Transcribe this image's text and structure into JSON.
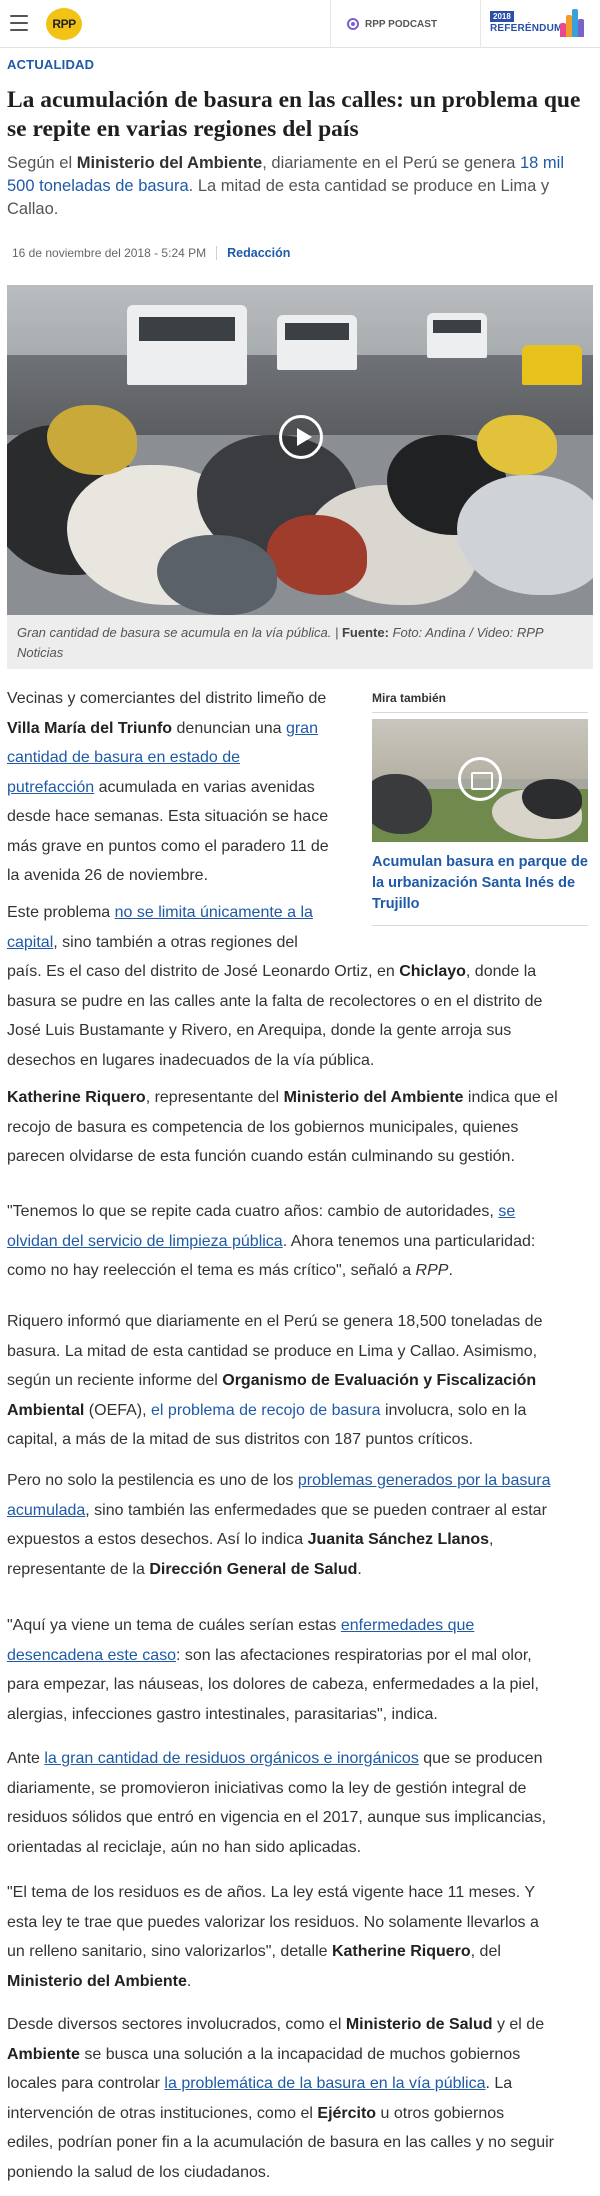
{
  "header": {
    "logo": "RPP",
    "podcast_label": "RPP PODCAST",
    "referendum_year": "2018",
    "referendum_label": "REFERÉNDUM"
  },
  "article": {
    "section": "ACTUALIDAD",
    "title": "La acumulación de basura en las calles: un problema que se repite en varias regiones del país",
    "lede": {
      "t1": "Según el ",
      "b1": "Ministerio del Ambiente",
      "t2": ", diariamente en el Perú se genera ",
      "hl": "18 mil 500 toneladas de basura",
      "t3": ". La mitad de esta cantidad se produce en Lima y Callao."
    },
    "date": "16 de noviembre del 2018 - 5:24 PM",
    "author": "Redacción",
    "caption": {
      "text": "Gran cantidad de basura se acumula en la vía pública. | ",
      "source_label": "Fuente:",
      "source_text": " Foto: Andina / Video: RPP Noticias"
    }
  },
  "related": {
    "heading": "Mira también",
    "title": "Acumulan basura en parque de la urbanización Santa Inés de Trujillo"
  },
  "body": {
    "p1": {
      "l1": "Vecinas y comerciantes del distrito limeño de",
      "b1": "Villa María del Triunfo",
      "t1": " denuncian una ",
      "a1a": "gran",
      "a1b": "cantidad de basura en estado de",
      "a1c": "putrefacción",
      "t2": " acumulada en varias avenidas",
      "l4": "desde hace semanas. Esta situación se hace",
      "l5": "más grave en puntos como el paradero 11 de",
      "l6": "la avenida 26 de noviembre."
    },
    "p2": {
      "t1": "Este problema ",
      "a1": "no se limita únicamente a la",
      "a2": "capital",
      "t2": ", sino también a otras regiones del",
      "l3": "país. Es el caso del distrito de José Leonardo Ortiz, en ",
      "b1": "Chiclayo",
      "t3": ", donde la",
      "l4": "basura se pudre en las calles ante la falta de recolectores o en el distrito de",
      "l5": "José Luis Bustamante y Rivero, en Arequipa, donde la gente arroja sus",
      "l6": "desechos en lugares inadecuados de la vía pública."
    },
    "p3": {
      "b1": "Katherine Riquero",
      "t1": ", representante del ",
      "b2": "Ministerio del Ambiente",
      "t2": " indica que el",
      "l2": "recojo de basura es competencia de los gobiernos municipales, quienes",
      "l3": "parecen olvidarse de esta función cuando están culminando su gestión."
    },
    "p4": {
      "t1": "\"Tenemos lo que se repite cada cuatro años: cambio de autoridades, ",
      "a1": "se",
      "a2": "olvidan del servicio de limpieza pública",
      "t2": ". Ahora tenemos una particularidad:",
      "l3a": "como no hay reelección el tema es más crítico\", señaló a ",
      "i1": "RPP",
      "l3b": "."
    },
    "p5": {
      "l1": "Riquero informó que diariamente en el Perú se genera 18,500 toneladas de",
      "l2": "basura. La mitad de esta cantidad se produce en Lima y Callao. Asimismo,",
      "t1": "según un reciente informe del ",
      "b1": "Organismo de Evaluación y Fiscalización",
      "b2": "Ambiental",
      "t2": " (OEFA), ",
      "hl": "el problema de recojo de basura",
      "t3": " involucra, solo en la",
      "l5": "capital, a más de la mitad de sus distritos con 187 puntos críticos."
    },
    "p6": {
      "t1": "Pero no solo la pestilencia es uno de los ",
      "a1": "problemas generados por la basura",
      "a2": "acumulada",
      "t2": ", sino también las enfermedades que se pueden contraer al estar",
      "l3a": "expuestos a estos desechos. Así lo indica ",
      "b1": "Juanita Sánchez Llanos",
      "l3b": ",",
      "l4a": "representante de la ",
      "b2": "Dirección General de Salud",
      "l4b": "."
    },
    "p7": {
      "t1": "\"Aquí ya viene un tema de cuáles serían estas ",
      "a1": "enfermedades que",
      "a2": "desencadena este caso",
      "t2": ": son las afectaciones respiratorias por el mal olor,",
      "l3": "para empezar, las náuseas, los dolores de cabeza, enfermedades a la piel,",
      "l4": "alergias, infecciones gastro intestinales, parasitarias\", indica."
    },
    "p8": {
      "t1": "Ante ",
      "a1": "la gran cantidad de residuos orgánicos e inorgánicos",
      "t2": " que se producen",
      "l2": "diariamente, se promovieron iniciativas como la ley de gestión integral de",
      "l3": "residuos sólidos que entró en vigencia en el 2017, aunque sus implicancias,",
      "l4": "orientadas al reciclaje, aún no han sido aplicadas."
    },
    "p9": {
      "l1": "\"El tema de los residuos es de años. La ley está vigente hace 11 meses. Y",
      "l2": "esta ley te trae que puedes valorizar los residuos. No solamente llevarlos a",
      "t1": "un relleno sanitario, sino valorizarlos\", detalle ",
      "b1": "Katherine Riquero",
      "t2": ", del",
      "b2": "Ministerio del Ambiente",
      "t3": "."
    },
    "p10": {
      "t1": "Desde diversos sectores involucrados, como el ",
      "b1": "Ministerio de Salud",
      "t2": " y el de",
      "b2": "Ambiente",
      "t3": " se busca una solución a la incapacidad de muchos gobiernos",
      "t4": "locales para controlar ",
      "a1": "la problemática de la basura en la vía pública",
      "t5": ". La",
      "t6": "intervención de otras instituciones, como el ",
      "b3": "Ejército",
      "t7": " u otros gobiernos",
      "l5": "ediles, podrían poner fin a la acumulación de basura en las calles y no seguir",
      "l6": "poniendo la salud de los ciudadanos."
    }
  },
  "colors": {
    "link": "#1e5aa8",
    "logo_yellow": "#f2c315",
    "caption_bg": "#ededed"
  }
}
